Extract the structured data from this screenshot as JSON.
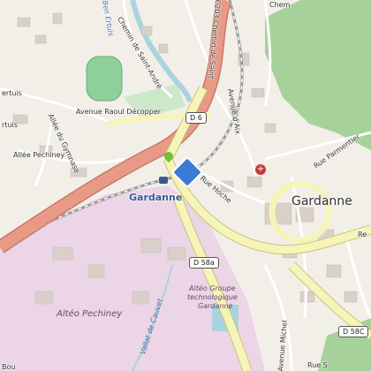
{
  "map": {
    "town": "Gardanne",
    "station": "Gardanne",
    "roads": {
      "d6": "D 6",
      "d58a": "D 58a",
      "d58c": "D 58C",
      "chemin_saint_andre": "Chemin de Saint-André",
      "chemin_d": "C203 Chemin de Saint",
      "avenue_raoul": "Avenue Raoul Décopper",
      "allee_pechiney": "Allée Pechiney",
      "allee_gymnase": "Allée du Gymnase",
      "rue_hoche": "Rue Hoche",
      "avenue_aix": "Avenue d'Aix",
      "rue_parmentier": "Rue Parmentier",
      "avenue_michel": "Avenue Michel",
      "vallat": "Vallat de Cauvet",
      "bourg": "Bou",
      "rue_s": "Rue S",
      "chem_top": "Chem",
      "ertuis": "ertuis",
      "ruis": "rtuis",
      "ben_ertuis": "Ben Ertuis",
      "re": "Re"
    },
    "areas": {
      "alteo": "Altéo Pechiney",
      "alteo_groupe_l1": "Altéo Groupe",
      "alteo_groupe_l2": "technologique",
      "alteo_groupe_l3": "Gardanne"
    },
    "colors": {
      "background": "#f2efe9",
      "industrial": "#ebd5e6",
      "wood": "#a7d19a",
      "motorway": "#e89a86",
      "primary": "#f6f4b8",
      "water": "#aad3df",
      "building": "#d9d0c9"
    },
    "pois": {
      "station_icon": "rail-station-icon",
      "hospital_icon": "hospital-icon",
      "signpost_icon": "directions-icon"
    }
  }
}
